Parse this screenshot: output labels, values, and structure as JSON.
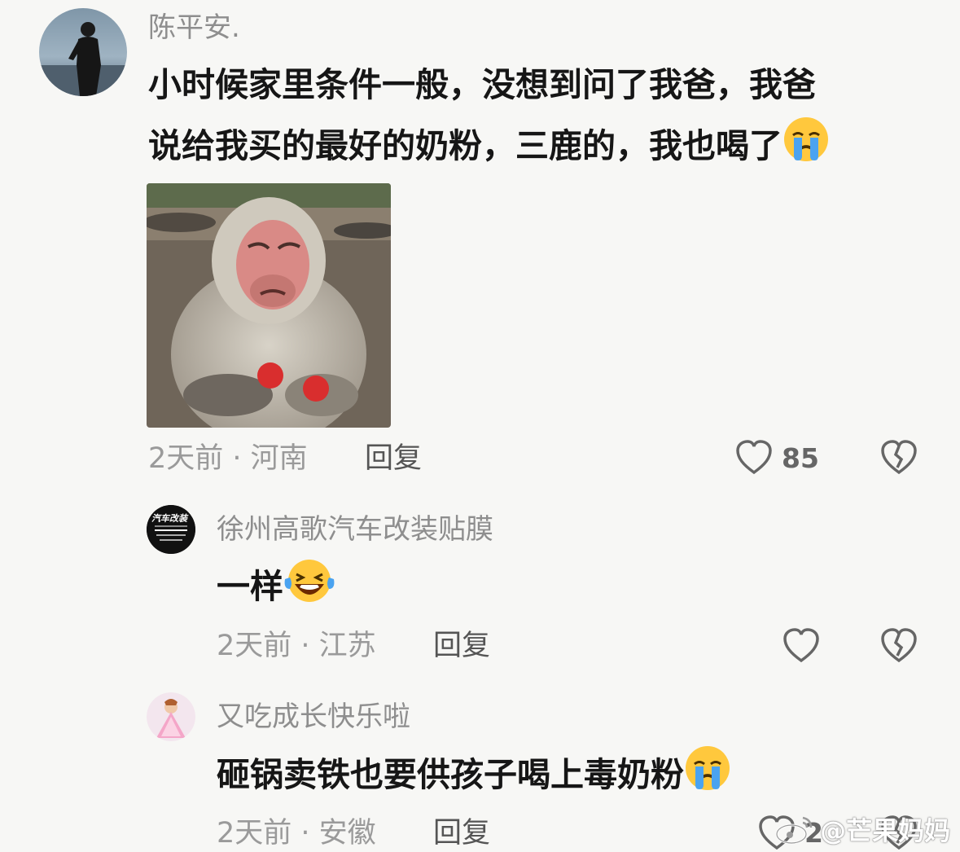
{
  "comments": [
    {
      "username": "陈平安.",
      "text_line1": "小时候家里条件一般，没想到问了我爸，我爸",
      "text_line2": "说给我买的最好的奶粉，三鹿的，我也喝了",
      "emoji": "crying-face",
      "time": "2天前",
      "location": "河南",
      "reply_label": "回复",
      "like_count": "85"
    },
    {
      "username": "徐州高歌汽车改装贴膜",
      "avatar_logo_text": "汽车改装",
      "text": "一样",
      "emoji": "laughing-tears-face",
      "time": "2天前",
      "location": "江苏",
      "reply_label": "回复"
    },
    {
      "username": "又吃成长快乐啦",
      "text": "砸锅卖铁也要供孩子喝上毒奶粉",
      "emoji": "crying-face",
      "time": "2天前",
      "location": "安徽",
      "reply_label": "回复",
      "like_count": "2"
    }
  ],
  "watermark": "@芒果妈妈",
  "colors": {
    "background": "#f7f7f5",
    "text": "#161616",
    "meta": "#9a9a9a",
    "emoji_yellow": "#ffc83d"
  }
}
